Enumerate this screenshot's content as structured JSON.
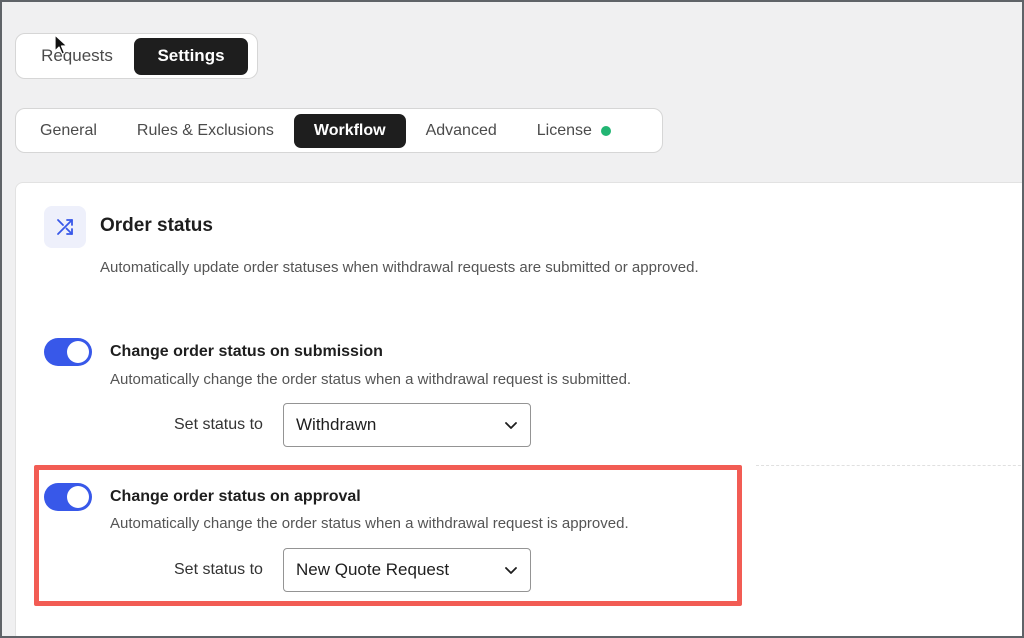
{
  "top_tabs": {
    "requests": "Requests",
    "settings": "Settings"
  },
  "settings_tabs": [
    {
      "label": "General"
    },
    {
      "label": "Rules & Exclusions"
    },
    {
      "label": "Workflow"
    },
    {
      "label": "Advanced"
    },
    {
      "label": "License"
    }
  ],
  "active_tab": "Workflow",
  "license_status_color": "#22b573",
  "section": {
    "icon": "shuffle-icon",
    "title": "Order status",
    "description": "Automatically update order statuses when withdrawal requests are submitted or approved."
  },
  "options": [
    {
      "enabled": true,
      "title": "Change order status on submission",
      "description": "Automatically change the order status when a withdrawal request is submitted.",
      "set_label": "Set status to",
      "selected_value": "Withdrawn"
    },
    {
      "enabled": true,
      "title": "Change order status on approval",
      "description": "Automatically change the order status when a withdrawal request is approved.",
      "set_label": "Set status to",
      "selected_value": "New Quote Request"
    }
  ],
  "colors": {
    "accent": "#3858e9",
    "highlight": "#f25c54"
  }
}
